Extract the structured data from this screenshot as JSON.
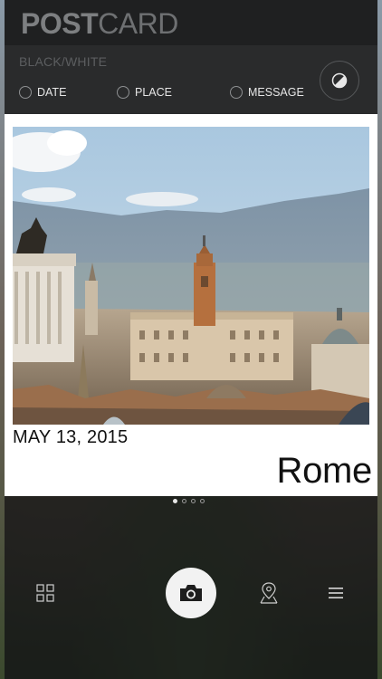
{
  "header": {
    "title_bold": "POST",
    "title_thin": "CARD"
  },
  "filter": {
    "label": "BLACK/WHITE"
  },
  "options": [
    {
      "label": "DATE"
    },
    {
      "label": "PLACE"
    },
    {
      "label": "MESSAGE"
    }
  ],
  "postcard": {
    "date": "MAY 13, 2015",
    "place": "Rome"
  },
  "pager": {
    "pages": 4,
    "current": 1
  },
  "toolbar": {
    "icons": [
      "grid-icon",
      "camera-icon",
      "location-pin-icon",
      "menu-icon"
    ]
  },
  "colors": {
    "panel": "#2a2b2c",
    "title_bar": "#1f2021",
    "card": "#ffffff",
    "camera_button": "#f2f2f2"
  }
}
